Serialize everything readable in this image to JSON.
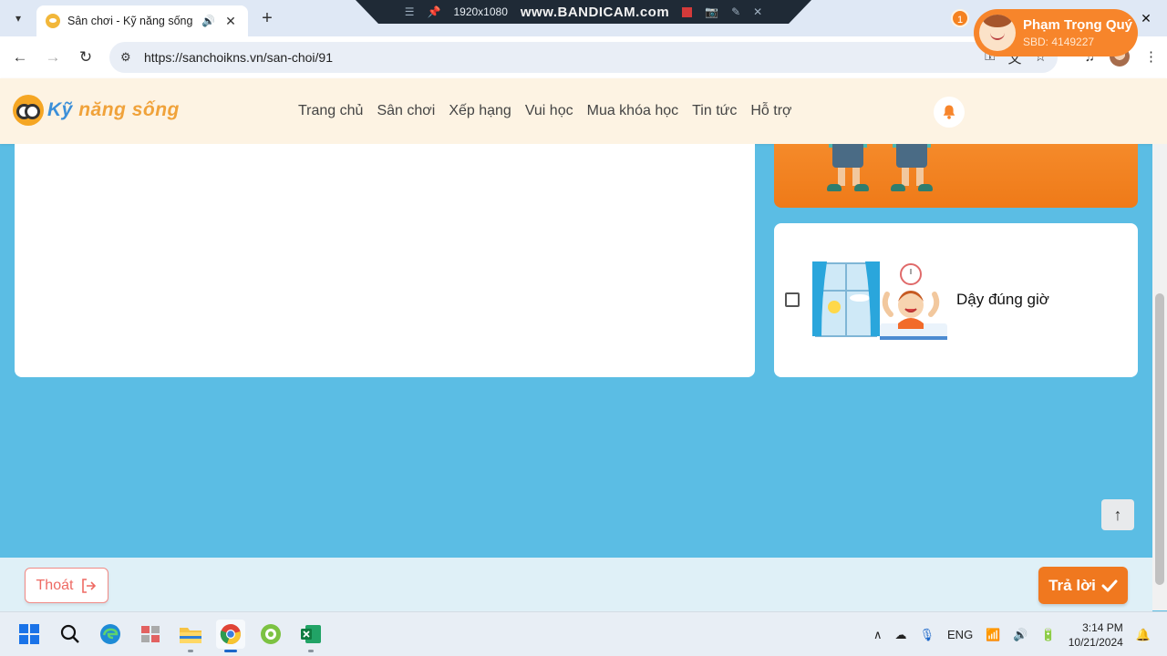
{
  "browser": {
    "tab_title": "Sân chơi - Kỹ năng sống",
    "url": "https://sanchoikns.vn/san-choi/91"
  },
  "recorder": {
    "resolution": "1920x1080",
    "brand": "www.BANDICAM.com"
  },
  "site": {
    "logo_text_1": "Kỹ",
    "logo_text_2": "năng sống",
    "nav": [
      "Trang chủ",
      "Sân chơi",
      "Xếp hạng",
      "Vui học",
      "Mua khóa học",
      "Tin tức",
      "Hỗ trợ"
    ],
    "notification_count": "1",
    "user_name": "Phạm Trọng Quý",
    "user_sbd": "SBD: 4149227"
  },
  "option": {
    "label": "Dậy đúng giờ",
    "checked": false
  },
  "footer": {
    "exit_label": "Thoát",
    "answer_label": "Trả lời"
  },
  "taskbar": {
    "language": "ENG",
    "time": "3:14 PM",
    "date": "10/21/2024"
  },
  "colors": {
    "page_bg": "#5bbde4",
    "accent_orange": "#f0781f",
    "exit_red": "#ee6a63"
  }
}
